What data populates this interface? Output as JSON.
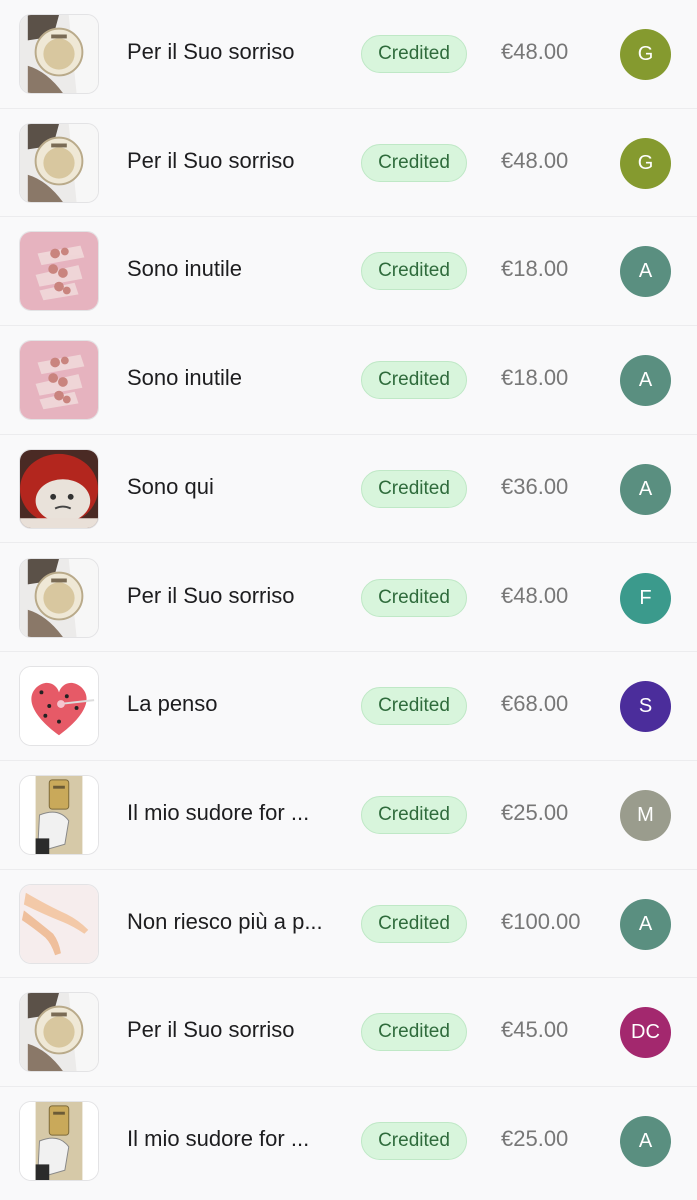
{
  "transactions": [
    {
      "title": "Per il Suo sorriso",
      "status": "Credited",
      "amount": "€48.00",
      "avatar": "G",
      "avatar_color": "#859a2f",
      "thumb": "cup"
    },
    {
      "title": "Per il Suo sorriso",
      "status": "Credited",
      "amount": "€48.00",
      "avatar": "G",
      "avatar_color": "#859a2f",
      "thumb": "cup"
    },
    {
      "title": "Sono inutile",
      "status": "Credited",
      "amount": "€18.00",
      "avatar": "A",
      "avatar_color": "#5a8f80",
      "thumb": "candy"
    },
    {
      "title": "Sono inutile",
      "status": "Credited",
      "amount": "€18.00",
      "avatar": "A",
      "avatar_color": "#5a8f80",
      "thumb": "candy"
    },
    {
      "title": "Sono qui",
      "status": "Credited",
      "amount": "€36.00",
      "avatar": "A",
      "avatar_color": "#5a8f80",
      "thumb": "face"
    },
    {
      "title": "Per il Suo sorriso",
      "status": "Credited",
      "amount": "€48.00",
      "avatar": "F",
      "avatar_color": "#3b9a8c",
      "thumb": "cup"
    },
    {
      "title": "La penso",
      "status": "Credited",
      "amount": "€68.00",
      "avatar": "S",
      "avatar_color": "#4b2d9b",
      "thumb": "heart"
    },
    {
      "title": "Il mio sudore for ...",
      "status": "Credited",
      "amount": "€25.00",
      "avatar": "M",
      "avatar_color": "#9a9c8d",
      "thumb": "door"
    },
    {
      "title": "Non riesco più a p...",
      "status": "Credited",
      "amount": "€100.00",
      "avatar": "A",
      "avatar_color": "#5a8f80",
      "thumb": "legs"
    },
    {
      "title": "Per il Suo sorriso",
      "status": "Credited",
      "amount": "€45.00",
      "avatar": "DC",
      "avatar_color": "#a3286e",
      "thumb": "cup"
    },
    {
      "title": "Il mio sudore for ...",
      "status": "Credited",
      "amount": "€25.00",
      "avatar": "A",
      "avatar_color": "#5a8f80",
      "thumb": "door"
    }
  ]
}
